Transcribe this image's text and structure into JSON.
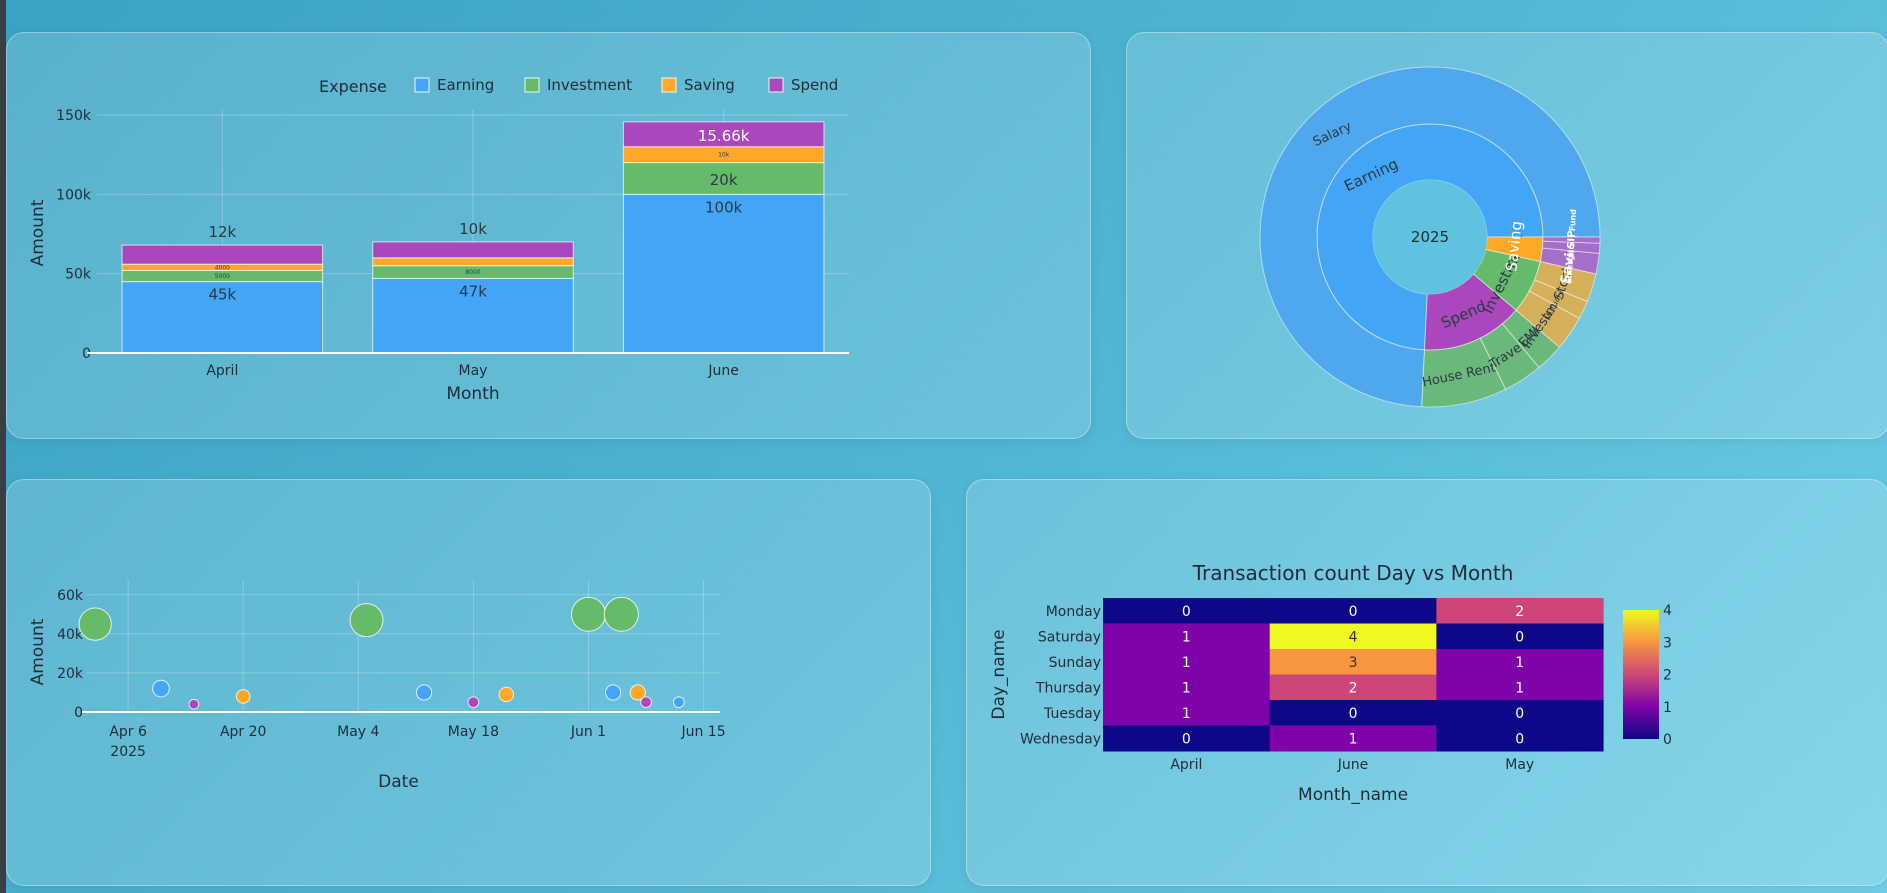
{
  "colors": {
    "earning": "#42a5f5",
    "investment": "#66bb6a",
    "saving": "#ffa726",
    "spend": "#ab47bc"
  },
  "chart_data": [
    {
      "id": "bar",
      "type": "bar",
      "stacked": true,
      "legend_title": "Expense",
      "legend_position": "top",
      "categories": [
        "April",
        "May",
        "June"
      ],
      "series": [
        {
          "name": "Earning",
          "values": [
            45000,
            47000,
            100000
          ],
          "labels": [
            "45k",
            "47k",
            "100k"
          ]
        },
        {
          "name": "Investment",
          "values": [
            7000,
            8000,
            20000
          ],
          "labels": [
            "5000",
            "8000",
            "20k"
          ]
        },
        {
          "name": "Saving",
          "values": [
            4000,
            5000,
            10000
          ],
          "labels": [
            "4000",
            "",
            "10k"
          ]
        },
        {
          "name": "Spend",
          "values": [
            12000,
            10000,
            15660
          ],
          "labels": [
            "12k",
            "10k",
            "15.66k"
          ]
        }
      ],
      "xlabel": "Month",
      "ylabel": "Amount",
      "ylim": [
        0,
        150000
      ],
      "yticks": [
        0,
        50000,
        100000,
        150000
      ],
      "yticklabels": [
        "0",
        "50k",
        "100k",
        "150k"
      ],
      "grid": true
    },
    {
      "id": "sunburst",
      "type": "sunburst",
      "root": "2025",
      "inner": [
        {
          "name": "Earning",
          "value": 192000
        },
        {
          "name": "Spend",
          "value": 37660
        },
        {
          "name": "Investment",
          "value": 20000
        },
        {
          "name": "Saving",
          "value": 9000
        }
      ],
      "outer": [
        {
          "name": "Salary",
          "parent": "Earning",
          "value": 192000
        },
        {
          "name": "House Rent",
          "parent": "Spend",
          "value": 21000
        },
        {
          "name": "Travel",
          "parent": "Spend",
          "value": 9660
        },
        {
          "name": "EMI",
          "parent": "Spend",
          "value": 7000
        },
        {
          "name": "Investment",
          "parent": "Investment",
          "value": 8500
        },
        {
          "name": "Mutual Fund",
          "parent": "Investment",
          "value": 4500
        },
        {
          "name": "Stocks",
          "parent": "Investment",
          "value": 7000
        },
        {
          "name": "Saving",
          "parent": "Saving",
          "value": 5000
        },
        {
          "name": "Emergency Fund",
          "parent": "Saving",
          "value": 2500
        },
        {
          "name": "SIP",
          "parent": "Saving",
          "value": 1500
        }
      ]
    },
    {
      "id": "scatter",
      "type": "scatter",
      "xlabel": "Date",
      "ylabel": "Amount",
      "xlim": [
        "2025-04-01",
        "2025-06-17"
      ],
      "xticks": [
        "2025-04-06",
        "2025-04-20",
        "2025-05-04",
        "2025-05-18",
        "2025-06-01",
        "2025-06-15"
      ],
      "xticklabels": [
        "Apr 6",
        "Apr 20",
        "May 4",
        "May 18",
        "Jun 1",
        "Jun 15"
      ],
      "year_label": "2025",
      "ylim": [
        0,
        65000
      ],
      "yticks": [
        0,
        20000,
        40000,
        60000
      ],
      "yticklabels": [
        "0",
        "20k",
        "40k",
        "60k"
      ],
      "points": [
        {
          "date": "2025-04-02",
          "amount": 45000,
          "category": "Investment"
        },
        {
          "date": "2025-04-10",
          "amount": 12000,
          "category": "Earning"
        },
        {
          "date": "2025-04-14",
          "amount": 4000,
          "category": "Spend"
        },
        {
          "date": "2025-04-20",
          "amount": 8000,
          "category": "Saving"
        },
        {
          "date": "2025-05-05",
          "amount": 47000,
          "category": "Investment"
        },
        {
          "date": "2025-05-12",
          "amount": 10000,
          "category": "Earning"
        },
        {
          "date": "2025-05-18",
          "amount": 5000,
          "category": "Spend"
        },
        {
          "date": "2025-05-22",
          "amount": 9000,
          "category": "Saving"
        },
        {
          "date": "2025-06-01",
          "amount": 50000,
          "category": "Investment"
        },
        {
          "date": "2025-06-05",
          "amount": 50000,
          "category": "Investment"
        },
        {
          "date": "2025-06-04",
          "amount": 10000,
          "category": "Earning"
        },
        {
          "date": "2025-06-07",
          "amount": 10000,
          "category": "Saving"
        },
        {
          "date": "2025-06-08",
          "amount": 5000,
          "category": "Spend"
        },
        {
          "date": "2025-06-12",
          "amount": 5000,
          "category": "Earning"
        }
      ]
    },
    {
      "id": "heatmap",
      "type": "heatmap",
      "title": "Transaction count Day vs Month",
      "xlabel": "Month_name",
      "ylabel": "Day_name",
      "columns": [
        "April",
        "June",
        "May"
      ],
      "rows": [
        "Monday",
        "Saturday",
        "Sunday",
        "Thursday",
        "Tuesday",
        "Wednesday"
      ],
      "values": [
        [
          0,
          0,
          2
        ],
        [
          1,
          4,
          0
        ],
        [
          1,
          3,
          1
        ],
        [
          1,
          2,
          1
        ],
        [
          1,
          0,
          0
        ],
        [
          0,
          1,
          0
        ]
      ],
      "colorbar_ticks": [
        0,
        1,
        2,
        3,
        4
      ]
    }
  ]
}
